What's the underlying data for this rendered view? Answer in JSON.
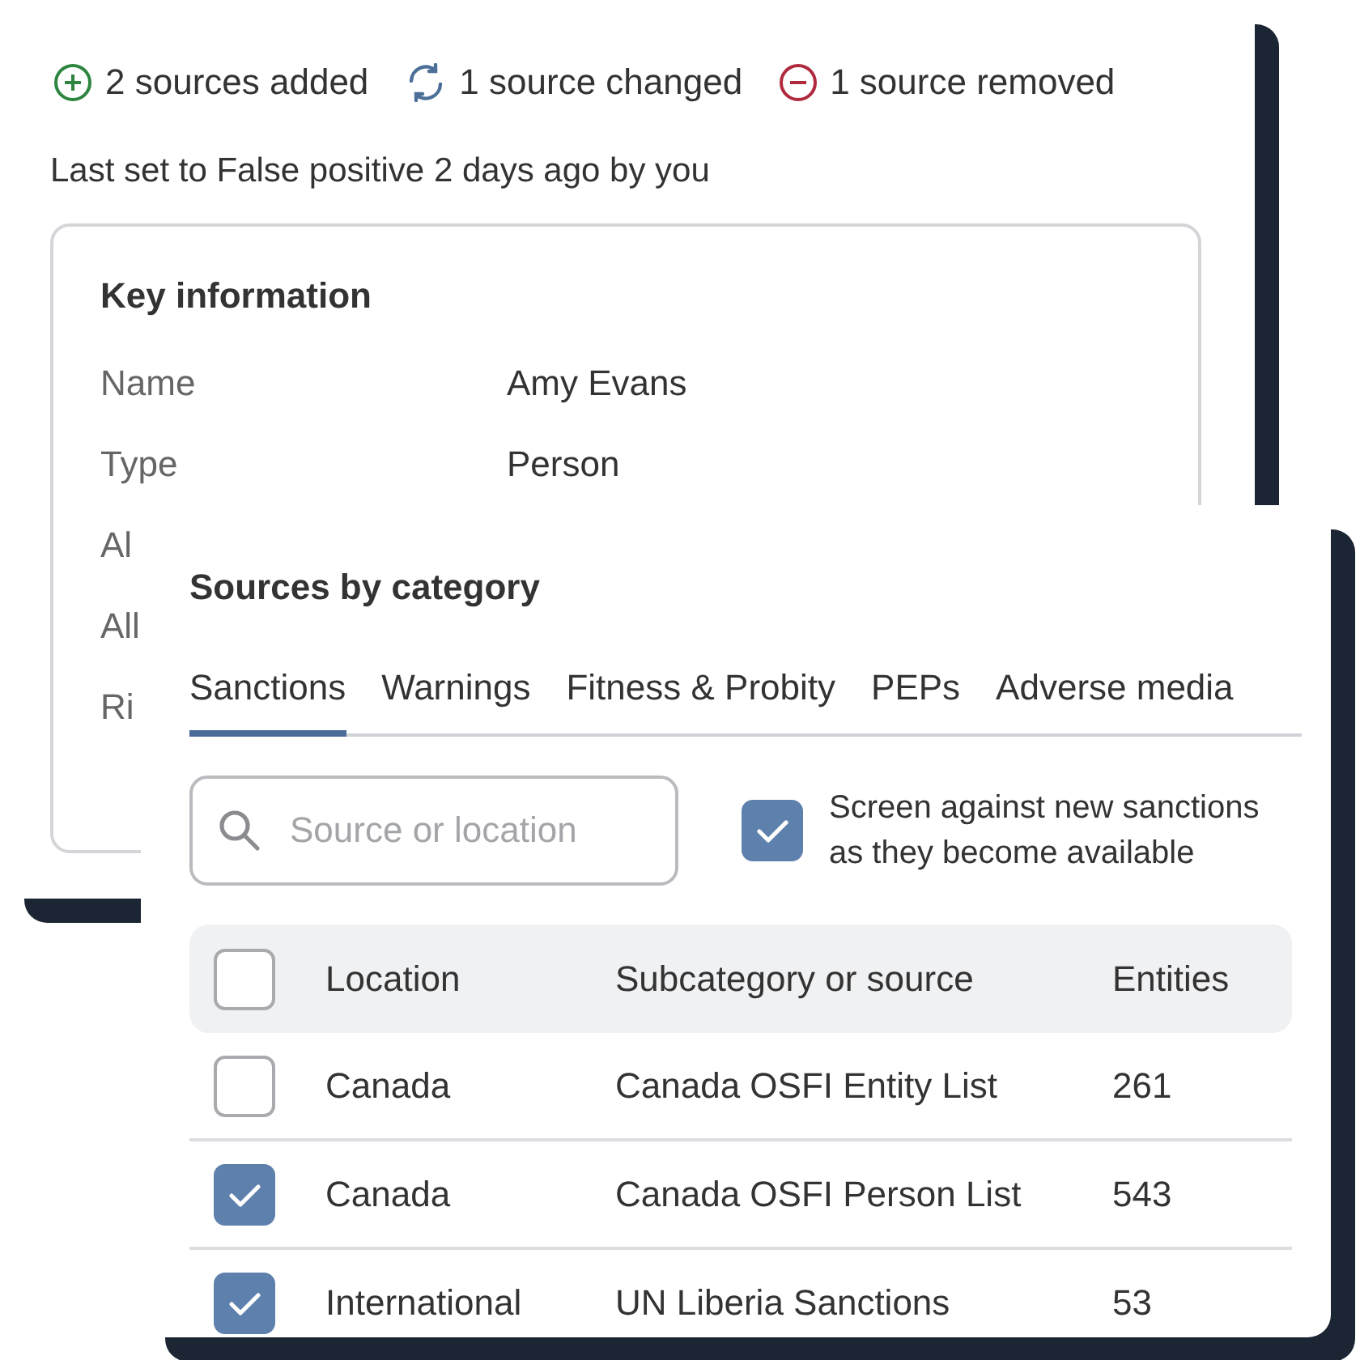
{
  "changes": [
    {
      "kind": "added",
      "text": "2 sources added"
    },
    {
      "kind": "changed",
      "text": "1 source changed"
    },
    {
      "kind": "removed",
      "text": "1 source removed"
    }
  ],
  "status_line": "Last set to False positive 2 days ago by you",
  "key_information": {
    "title": "Key information",
    "rows": [
      {
        "label": "Name",
        "value": "Amy Evans"
      },
      {
        "label": "Type",
        "value": "Person"
      },
      {
        "label": "Al"
      },
      {
        "label": "All"
      },
      {
        "label": "Ri"
      }
    ]
  },
  "sources_panel": {
    "title": "Sources by category",
    "tabs": [
      {
        "label": "Sanctions",
        "selected": true
      },
      {
        "label": "Warnings",
        "selected": false
      },
      {
        "label": "Fitness & Probity",
        "selected": false
      },
      {
        "label": "PEPs",
        "selected": false
      },
      {
        "label": "Adverse media",
        "selected": false
      }
    ],
    "search": {
      "placeholder": "Source or location"
    },
    "auto_screen": {
      "label": "Screen against new sanctions as they become available",
      "checked": true
    },
    "table": {
      "columns": [
        "Location",
        "Subcategory or source",
        "Entities"
      ],
      "select_all_checked": false,
      "rows": [
        {
          "checked": false,
          "cells": [
            "Canada",
            "Canada OSFI Entity List",
            "261"
          ]
        },
        {
          "checked": true,
          "cells": [
            "Canada",
            "Canada OSFI Person List",
            "543"
          ]
        },
        {
          "checked": true,
          "cells": [
            "International",
            "UN Liberia Sanctions",
            "53"
          ]
        }
      ]
    }
  }
}
